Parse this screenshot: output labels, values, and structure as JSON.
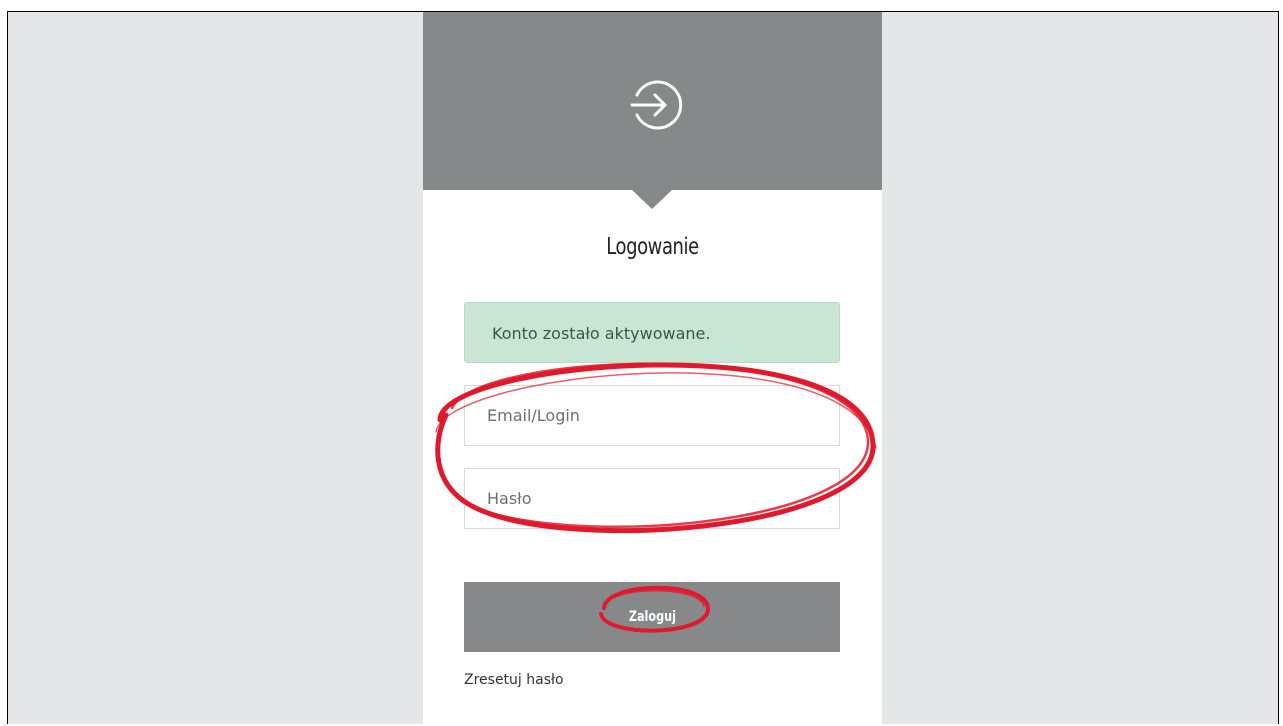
{
  "login": {
    "title": "Logowanie",
    "alert_message": "Konto zostało aktywowane.",
    "email_placeholder": "Email/Login",
    "password_placeholder": "Hasło",
    "submit_label": "Zaloguj",
    "reset_link_label": "Zresetuj hasło"
  },
  "icons": {
    "header_icon": "sign-in-arrow-circle-icon"
  },
  "colors": {
    "header_background": "#878889",
    "page_background": "#e5e6e8",
    "alert_background": "#c8e6d3",
    "alert_text": "#355a3e",
    "button_background": "#878889",
    "annotation_stroke": "#e1192c"
  }
}
